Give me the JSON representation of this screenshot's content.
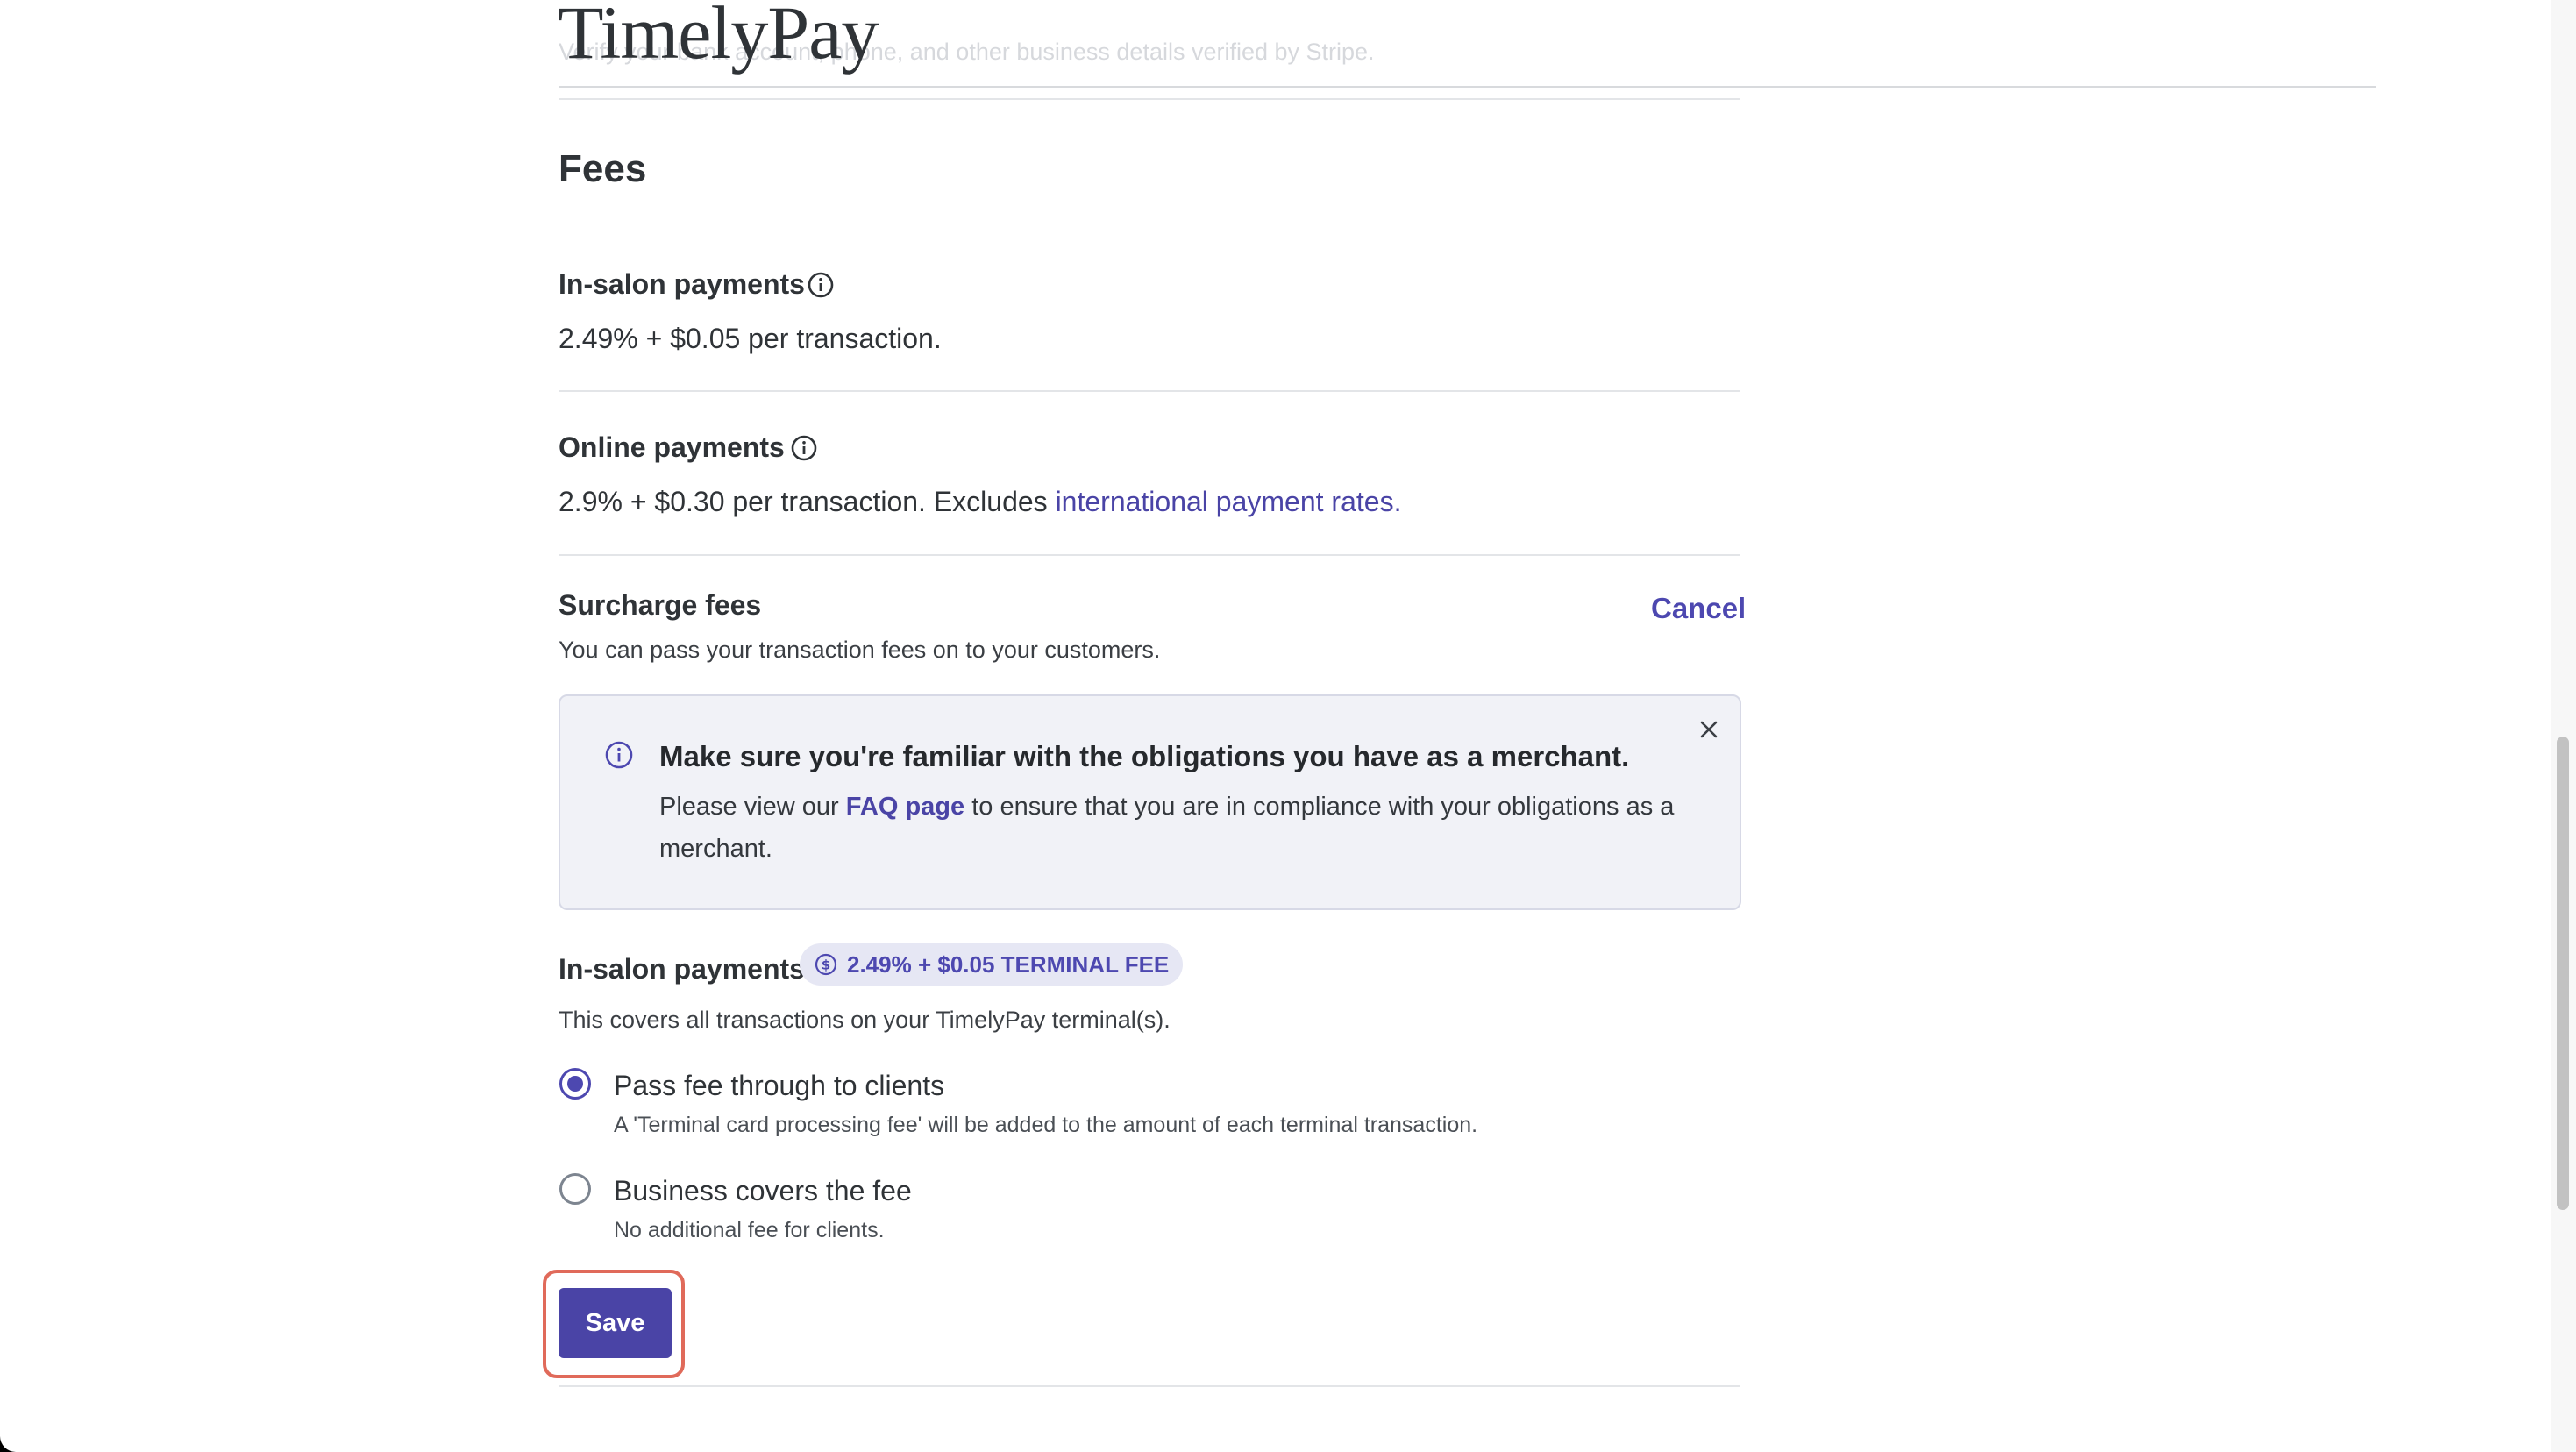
{
  "header": {
    "logo": "TimelyPay",
    "obscured_subtitle": "Verify your bank account, phone, and other business details verified by Stripe."
  },
  "fees": {
    "heading": "Fees",
    "in_salon": {
      "label": "In-salon payments",
      "rate": "2.49% + $0.05 per transaction."
    },
    "online": {
      "label": "Online payments",
      "rate_prefix": "2.9% + $0.30 per transaction. Excludes ",
      "rate_link": "international payment rates."
    }
  },
  "surcharge": {
    "title": "Surcharge fees",
    "cancel_label": "Cancel",
    "description": "You can pass your transaction fees on to your customers.",
    "notice": {
      "title": "Make sure you're familiar with the obligations you have as a merchant.",
      "text_prefix": "Please view our ",
      "link": "FAQ page",
      "text_suffix": " to ensure that you are in compliance with your obligations as a merchant."
    },
    "in_salon": {
      "label": "In-salon payments",
      "badge": "2.49% + $0.05 TERMINAL FEE",
      "description": "This covers all transactions on your TimelyPay terminal(s)."
    },
    "options": [
      {
        "label": "Pass fee through to clients",
        "help": "A 'Terminal card processing fee' will be added to the amount of each terminal transaction.",
        "selected": true
      },
      {
        "label": "Business covers the fee",
        "help": "No additional fee for clients.",
        "selected": false
      }
    ],
    "save_label": "Save"
  },
  "colors": {
    "accent": "#4a44a6",
    "highlight_ring": "#e06a5a",
    "notice_bg": "#f1f2f7"
  }
}
